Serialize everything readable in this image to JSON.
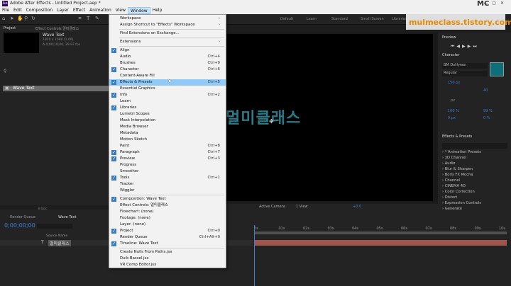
{
  "app": {
    "title": "Adobe After Effects - Untitled Project.aep *",
    "icon_text": "Ae"
  },
  "menu": [
    "File",
    "Edit",
    "Composition",
    "Layer",
    "Effect",
    "Animation",
    "View",
    "Window",
    "Help"
  ],
  "active_menu": "Window",
  "workspaces": [
    "Default",
    "Learn",
    "Standard",
    "Small Screen",
    "Libraries"
  ],
  "project_panel": {
    "tab": "Project",
    "effect_controls_tab": "Effect Controls 멀미클래스",
    "comp_name": "Wave Text",
    "comp_info_1": "1920 x 1080 (1.00)",
    "comp_info_2": "Δ 0;00;10;00, 29.97 fps",
    "item_label": "Wave Text",
    "bpc": "8 bpc"
  },
  "composition": {
    "text": "멀미클래스",
    "active_camera": "Active Camera",
    "view_count": "1 View",
    "offset": "+0.0"
  },
  "window_menu": [
    {
      "label": "Workspace",
      "shortcut": "",
      "checked": false,
      "arrow": true
    },
    {
      "label": "Assign Shortcut to \"Effects\" Workspace",
      "shortcut": "",
      "checked": false,
      "arrow": true
    },
    {
      "sep": true
    },
    {
      "label": "Find Extensions on Exchange...",
      "shortcut": "",
      "checked": false
    },
    {
      "sep": true
    },
    {
      "label": "Extensions",
      "shortcut": "",
      "checked": false,
      "arrow": true
    },
    {
      "sep": true
    },
    {
      "label": "Align",
      "shortcut": "",
      "checked": true
    },
    {
      "label": "Audio",
      "shortcut": "Ctrl+4",
      "checked": false
    },
    {
      "label": "Brushes",
      "shortcut": "Ctrl+9",
      "checked": false
    },
    {
      "label": "Character",
      "shortcut": "Ctrl+6",
      "checked": true
    },
    {
      "label": "Content-Aware Fill",
      "shortcut": "",
      "checked": false
    },
    {
      "label": "Effects & Presets",
      "shortcut": "Ctrl+5",
      "checked": true,
      "highlight": true
    },
    {
      "label": "Essential Graphics",
      "shortcut": "",
      "checked": false
    },
    {
      "label": "Info",
      "shortcut": "Ctrl+2",
      "checked": true
    },
    {
      "label": "Learn",
      "shortcut": "",
      "checked": false
    },
    {
      "label": "Libraries",
      "shortcut": "",
      "checked": true
    },
    {
      "label": "Lumetri Scopes",
      "shortcut": "",
      "checked": false
    },
    {
      "label": "Mask Interpolation",
      "shortcut": "",
      "checked": false
    },
    {
      "label": "Media Browser",
      "shortcut": "",
      "checked": false
    },
    {
      "label": "Metadata",
      "shortcut": "",
      "checked": false
    },
    {
      "label": "Motion Sketch",
      "shortcut": "",
      "checked": false
    },
    {
      "label": "Paint",
      "shortcut": "Ctrl+8",
      "checked": false
    },
    {
      "label": "Paragraph",
      "shortcut": "Ctrl+7",
      "checked": true
    },
    {
      "label": "Preview",
      "shortcut": "Ctrl+3",
      "checked": true
    },
    {
      "label": "Progress",
      "shortcut": "",
      "checked": false
    },
    {
      "label": "Smoother",
      "shortcut": "",
      "checked": false
    },
    {
      "label": "Tools",
      "shortcut": "Ctrl+1",
      "checked": true
    },
    {
      "label": "Tracker",
      "shortcut": "",
      "checked": false
    },
    {
      "label": "Wiggler",
      "shortcut": "",
      "checked": false
    },
    {
      "sep": true
    },
    {
      "label": "Composition: Wave Text",
      "shortcut": "",
      "checked": true
    },
    {
      "label": "Effect Controls: 멀미클래스",
      "shortcut": "",
      "checked": false
    },
    {
      "label": "Flowchart: (none)",
      "shortcut": "",
      "checked": false
    },
    {
      "label": "Footage: (none)",
      "shortcut": "",
      "checked": false
    },
    {
      "label": "Layer: (none)",
      "shortcut": "",
      "checked": false
    },
    {
      "label": "Project",
      "shortcut": "Ctrl+0",
      "checked": true
    },
    {
      "label": "Render Queue",
      "shortcut": "Ctrl+Alt+0",
      "checked": false
    },
    {
      "label": "Timeline: Wave Text",
      "shortcut": "",
      "checked": true
    },
    {
      "sep": true
    },
    {
      "label": "Create Nulls From Paths.jsx",
      "shortcut": "",
      "checked": false
    },
    {
      "label": "Duik Bassel.jsx",
      "shortcut": "",
      "checked": false
    },
    {
      "label": "VR Comp Editor.jsx",
      "shortcut": "",
      "checked": false
    }
  ],
  "right_panel": {
    "preview": "Preview",
    "character": "Character",
    "font": "BM DoHyeon",
    "style": "Regular",
    "size": "150 px",
    "tracking": "0",
    "leading_label": "Auto",
    "kerning": "40",
    "px": "px",
    "scale_v": "100 %",
    "scale_h": "99 %",
    "baseline": "0 px",
    "tsume": "0 %",
    "effects_title": "Effects & Presets",
    "effects": [
      "* Animation Presets",
      "3D Channel",
      "Audio",
      "Blur & Sharpen",
      "Boris FX Mocha",
      "Channel",
      "CINEMA 4D",
      "Color Correction",
      "Distort",
      "Expression Controls",
      "Generate"
    ]
  },
  "timeline": {
    "render_queue_tab": "Render Queue",
    "comp_tab": "Wave Text",
    "timecode": "0;00;00;00",
    "column_source": "Source Name",
    "layer_name": "멀미클래스",
    "ticks": [
      "0s",
      "02s",
      "04s",
      "06s",
      "08s",
      "10s"
    ],
    "ticks2": [
      "01s",
      "03s",
      "05s",
      "07s",
      "09s"
    ]
  },
  "watermark": {
    "text": "mulmeclass.tistory.com",
    "logo": "MC"
  }
}
